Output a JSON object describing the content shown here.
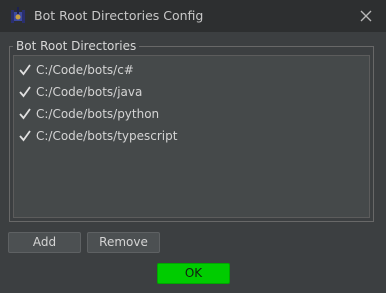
{
  "window": {
    "title": "Bot Root Directories Config",
    "icon": "robot-tank-icon"
  },
  "group": {
    "label": "Bot Root Directories",
    "items": [
      {
        "path": "C:/Code/bots/c#",
        "checked": true
      },
      {
        "path": "C:/Code/bots/java",
        "checked": true
      },
      {
        "path": "C:/Code/bots/python",
        "checked": true
      },
      {
        "path": "C:/Code/bots/typescript",
        "checked": true
      }
    ]
  },
  "buttons": {
    "add": "Add",
    "remove": "Remove",
    "ok": "OK"
  },
  "colors": {
    "background": "#3c3f41",
    "titlebar": "#2d2f30",
    "list_background": "#45494a",
    "ok_button": "#00cc00"
  }
}
